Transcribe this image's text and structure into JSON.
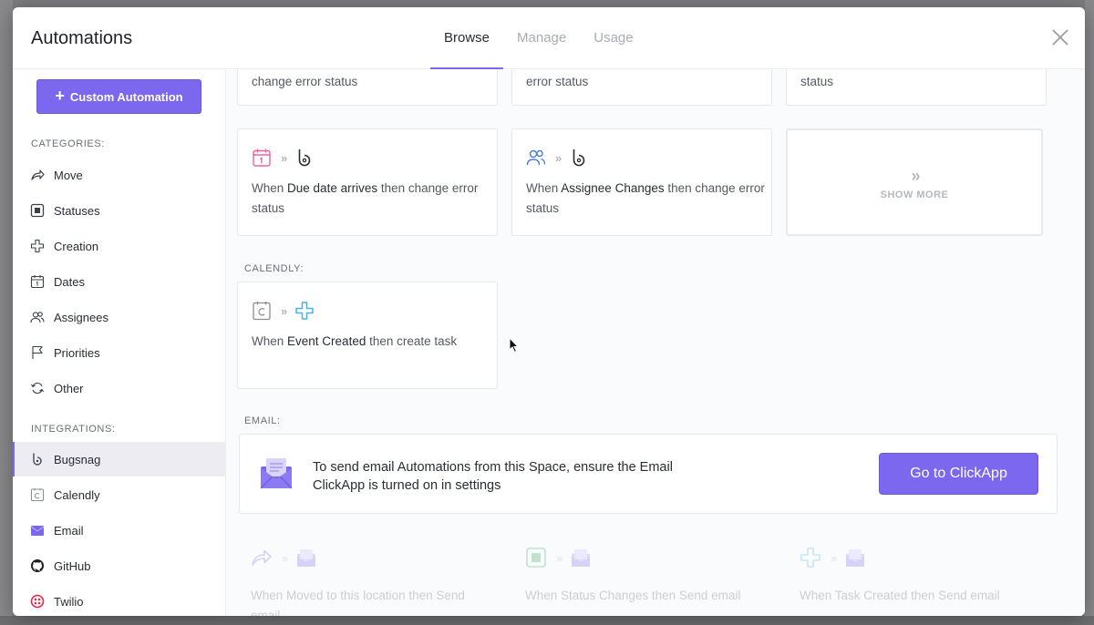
{
  "modal": {
    "title": "Automations",
    "tabs": [
      {
        "label": "Browse",
        "active": true
      },
      {
        "label": "Manage",
        "active": false
      },
      {
        "label": "Usage",
        "active": false
      }
    ]
  },
  "sidebar": {
    "custom_button": "Custom Automation",
    "categories_label": "CATEGORIES:",
    "categories": [
      {
        "label": "Move",
        "icon": "arrow-forward-icon"
      },
      {
        "label": "Statuses",
        "icon": "status-square-icon"
      },
      {
        "label": "Creation",
        "icon": "plus-outline-icon"
      },
      {
        "label": "Dates",
        "icon": "calendar-icon"
      },
      {
        "label": "Assignees",
        "icon": "users-icon"
      },
      {
        "label": "Priorities",
        "icon": "flag-icon"
      },
      {
        "label": "Other",
        "icon": "refresh-icon"
      }
    ],
    "integrations_label": "INTEGRATIONS:",
    "integrations": [
      {
        "label": "Bugsnag",
        "icon": "bugsnag-icon",
        "active": true
      },
      {
        "label": "Calendly",
        "icon": "calendly-icon"
      },
      {
        "label": "Email",
        "icon": "envelope-icon"
      },
      {
        "label": "GitHub",
        "icon": "github-icon"
      },
      {
        "label": "Twilio",
        "icon": "twilio-icon"
      }
    ]
  },
  "bugsnag_cards": {
    "top_row": [
      {
        "text": "change error status"
      },
      {
        "text": "error status"
      },
      {
        "text": "status"
      }
    ],
    "row2": [
      {
        "pre": "When ",
        "trigger": "Due date arrives",
        "post": " then change error status"
      },
      {
        "pre": "When ",
        "trigger": "Assignee Changes",
        "post": " then change error status"
      }
    ],
    "show_more": "SHOW MORE"
  },
  "calendly": {
    "label": "CALENDLY:",
    "card": {
      "pre": "When ",
      "trigger": "Event Created",
      "post": " then create task"
    }
  },
  "email": {
    "label": "EMAIL:",
    "banner_text": "To send email Automations from this Space, ensure the Email ClickApp is turned on in settings",
    "button": "Go to ClickApp",
    "faded_cards": [
      {
        "pre": "When ",
        "trigger": "Moved to this location",
        "post": " then Send email"
      },
      {
        "pre": "When ",
        "trigger": "Status Changes",
        "post": " then Send email"
      },
      {
        "pre": "When ",
        "trigger": "Task Created",
        "post": " then Send email"
      }
    ]
  },
  "colors": {
    "accent": "#7b68ee",
    "due_date": "#f0609f",
    "assignee": "#4a7fd6",
    "calendly_plus": "#49b1e8"
  }
}
